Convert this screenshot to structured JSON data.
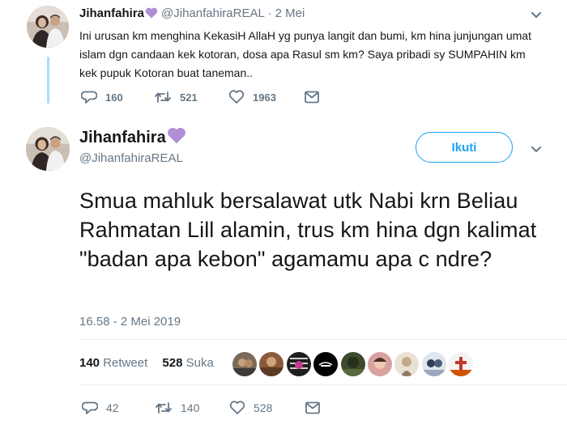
{
  "accent_color": "#1da1f2",
  "badge_color": "#b18ed6",
  "reply_tweet": {
    "display_name": "Jihanfahira",
    "handle": "@JihanfahiraREAL",
    "separator": "·",
    "date": "2 Mei",
    "body": "Ini urusan km menghina KekasiH AllaH yg punya langit dan bumi, km hina junjungan umat islam dgn candaan kek kotoran, dosa apa Rasul sm km? Saya pribadi sy SUMPAHIN km kek pupuk Kotoran buat taneman..",
    "replies": "160",
    "retweets": "521",
    "likes": "1963"
  },
  "main_tweet": {
    "display_name": "Jihanfahira",
    "handle": "@JihanfahiraREAL",
    "follow_label": "Ikuti",
    "body": "Smua mahluk bersalawat utk Nabi krn Beliau Rahmatan Lill alamin, trus km hina dgn kalimat \"badan apa kebon\" agamamu apa c ndre?",
    "timestamp": "16.58 - 2 Mei 2019",
    "retweet_count": "140",
    "retweet_label": "Retweet",
    "like_count": "528",
    "like_label": "Suka",
    "replies": "42",
    "retweets": "140",
    "likes": "528"
  },
  "icons": {
    "verified_badge": "purple-heart-icon",
    "more": "chevron-down-icon",
    "reply": "reply-bubble-icon",
    "retweet": "retweet-icon",
    "like": "heart-outline-icon",
    "message": "envelope-icon"
  }
}
